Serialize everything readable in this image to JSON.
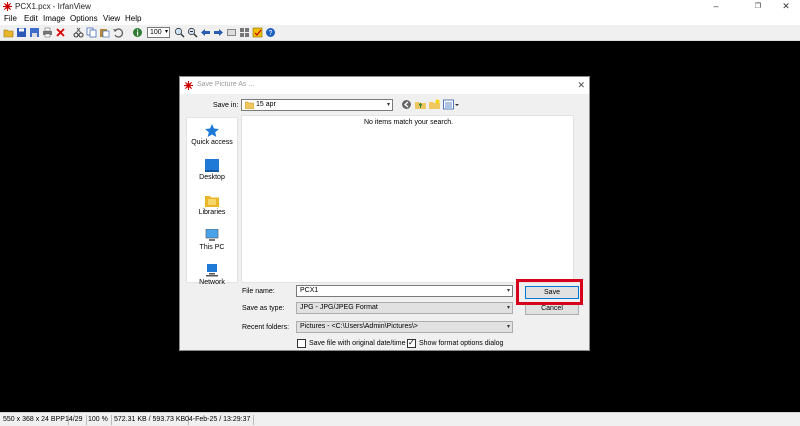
{
  "window": {
    "title": "PCX1.pcx - IrfanView",
    "minimize_glyph": "–",
    "restore_glyph": "❐",
    "close_glyph": "✕"
  },
  "menu": [
    "File",
    "Edit",
    "Image",
    "Options",
    "View",
    "Help"
  ],
  "toolbar": {
    "zoom_value": "100",
    "icons": [
      "open-folder-icon",
      "save-icon",
      "save-as-icon",
      "print-icon",
      "delete-icon",
      "cut-icon",
      "copy-icon",
      "paste-icon",
      "undo-icon",
      "info-icon",
      "zoom-in-icon",
      "zoom-out-icon",
      "previous-icon",
      "next-icon",
      "slideshow-icon",
      "thumbnails-icon",
      "paint-icon",
      "settings-icon",
      "help-icon"
    ]
  },
  "statusbar": {
    "dimensions": "550 x 368 x 24 BPP",
    "index": "14/29",
    "zoom": "100 %",
    "size": "572.31 KB / 593.73 KB",
    "datetime": "04-Feb-25 / 13:29:37"
  },
  "dialog": {
    "title": "Save Picture As ...",
    "save_in_label": "Save in:",
    "save_in_value": "15 apr",
    "empty_message": "No items match your search.",
    "places": [
      "Quick access",
      "Desktop",
      "Libraries",
      "This PC",
      "Network"
    ],
    "file_name_label": "File name:",
    "file_name_value": "PCX1",
    "save_as_type_label": "Save as type:",
    "save_as_type_value": "JPG - JPG/JPEG Format",
    "recent_folders_label": "Recent folders:",
    "recent_folders_value": "Pictures  -  <C:\\Users\\Admin\\Pictures\\>",
    "save_button": "Save",
    "cancel_button": "Cancel",
    "checkbox_original_date": "Save file with original date/time",
    "checkbox_original_date_checked": false,
    "checkbox_format_options": "Show format options dialog",
    "checkbox_format_options_checked": true
  },
  "colors": {
    "highlight": "#d6001c",
    "canvas": "#000000",
    "accent": "#0078d7"
  }
}
